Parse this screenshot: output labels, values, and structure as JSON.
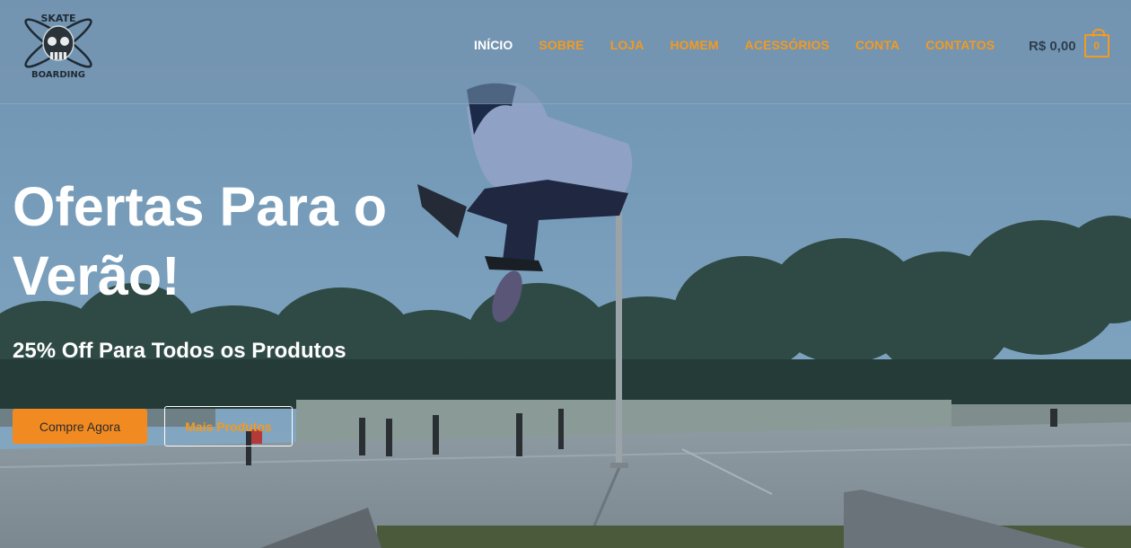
{
  "brand": {
    "logo_top_text": "SKATE",
    "logo_bottom_text": "BOARDING"
  },
  "nav": {
    "items": [
      {
        "label": "INÍCIO",
        "active": true
      },
      {
        "label": "SOBRE",
        "active": false
      },
      {
        "label": "LOJA",
        "active": false
      },
      {
        "label": "HOMEM",
        "active": false
      },
      {
        "label": "ACESSÓRIOS",
        "active": false
      },
      {
        "label": "CONTA",
        "active": false
      },
      {
        "label": "CONTATOS",
        "active": false
      }
    ]
  },
  "cart": {
    "total": "R$ 0,00",
    "count": "0"
  },
  "hero": {
    "headline": "Ofertas Para o Verão!",
    "subheadline": "25% Off Para Todos os Produtos",
    "primary_button": "Compre Agora",
    "secondary_button": "Mais Produtos"
  },
  "colors": {
    "accent": "#f39a1f",
    "nav_active": "#ffffff",
    "button_primary_bg": "#f28a22"
  }
}
